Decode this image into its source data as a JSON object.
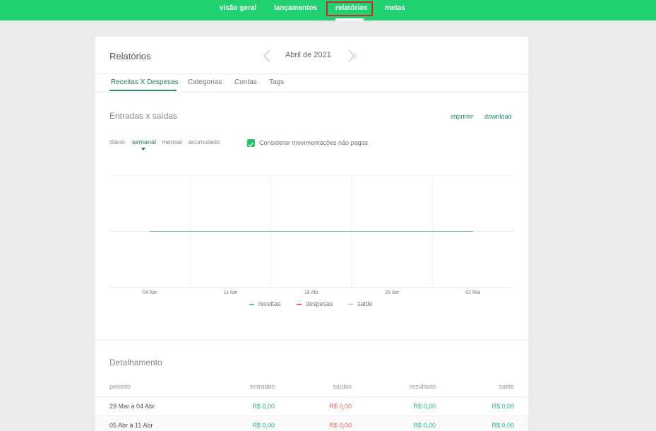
{
  "nav": {
    "items": [
      "visão geral",
      "lançamentos",
      "relatórios",
      "metas"
    ],
    "active": "relatórios"
  },
  "header": {
    "title": "Relatórios",
    "month": "Abril de 2021"
  },
  "tabs": [
    "Receitas X Despesas",
    "Categorias",
    "Contas",
    "Tags"
  ],
  "chart_section": {
    "title": "Entradas x saídas",
    "print": "imprimir",
    "download": "download",
    "periods": [
      "diário",
      "semanal",
      "mensal",
      "acumulado"
    ],
    "active_period": "semanal",
    "checkbox_label": "Considerar movimentações não pagas",
    "checkbox_checked": true
  },
  "chart_data": {
    "type": "line",
    "categories": [
      "04 Abr",
      "11 Abr",
      "18 Abr",
      "25 Abr",
      "02 Mai"
    ],
    "series": [
      {
        "name": "receitas",
        "color": "#5fc79a",
        "values": [
          0,
          0,
          0,
          0,
          0
        ]
      },
      {
        "name": "despesas",
        "color": "#e8645a",
        "values": [
          0,
          0,
          0,
          0,
          0
        ]
      },
      {
        "name": "saldo",
        "color": "#a9cdee",
        "values": [
          0,
          0,
          0,
          0,
          0
        ]
      }
    ],
    "legend_position": "bottom"
  },
  "details": {
    "title": "Detalhamento",
    "columns": [
      "periodo",
      "entradas",
      "saídas",
      "resultado",
      "saldo"
    ],
    "rows": [
      {
        "periodo": "29 Mar à 04 Abr",
        "entradas": "R$ 0,00",
        "saidas": "R$ 0,00",
        "resultado": "R$ 0,00",
        "saldo": "R$ 0,00"
      },
      {
        "periodo": "05 Abr à 11 Abr",
        "entradas": "R$ 0,00",
        "saidas": "R$ 0,00",
        "resultado": "R$ 0,00",
        "saldo": "R$ 0,00"
      }
    ]
  },
  "colors": {
    "brand": "#21d16f",
    "accent": "#2a8c5c",
    "positive": "#2db37a",
    "negative": "#e8645a",
    "highlight_box": "#c0302a"
  }
}
